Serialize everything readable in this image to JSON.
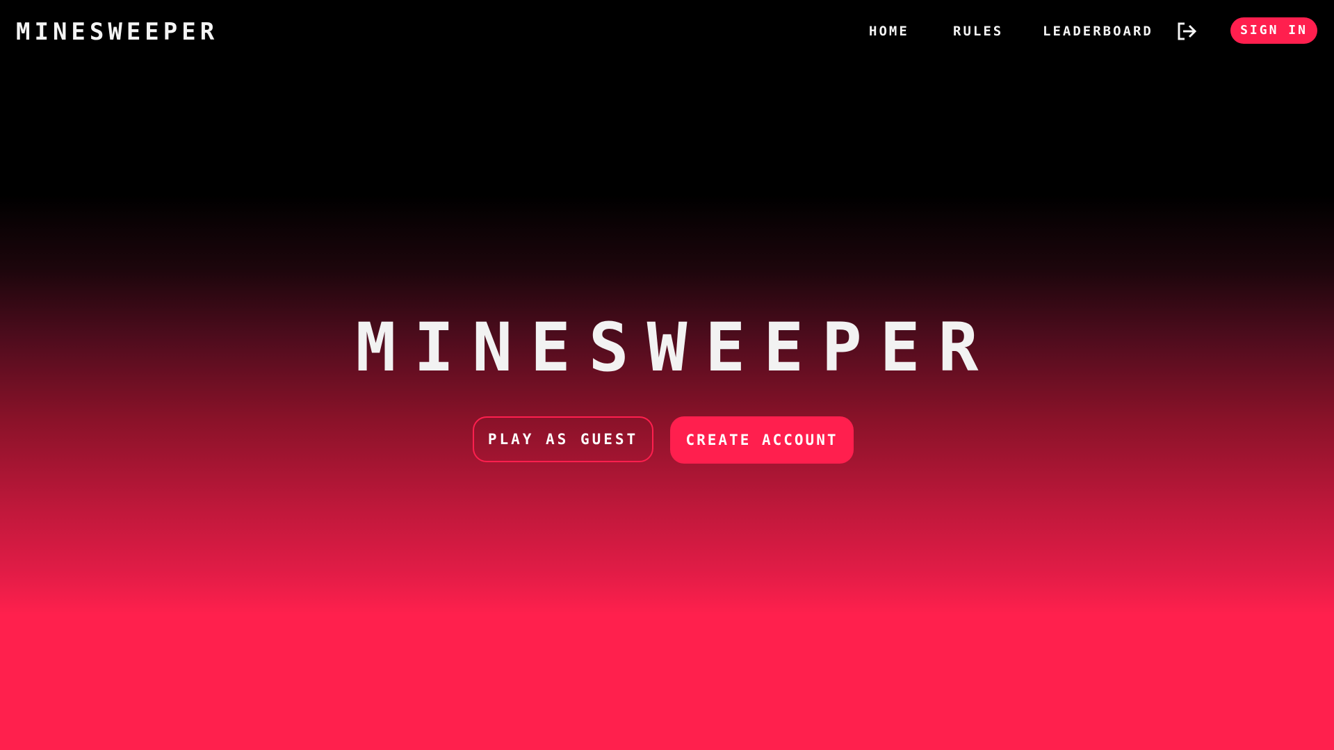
{
  "navbar": {
    "brand": "MINESWEEPER",
    "links": {
      "home": "HOME",
      "rules": "RULES",
      "leaderboard": "LEADERBOARD"
    },
    "logout_icon": "logout-icon",
    "signin_label": "SIGN IN"
  },
  "hero": {
    "title": "MINESWEEPER",
    "play_guest_label": "PLAY AS GUEST",
    "create_account_label": "CREATE ACCOUNT"
  },
  "colors": {
    "accent": "#ff1f4e",
    "background_top": "#000000",
    "background_bottom": "#ff204d",
    "text": "#f2f2f2"
  }
}
